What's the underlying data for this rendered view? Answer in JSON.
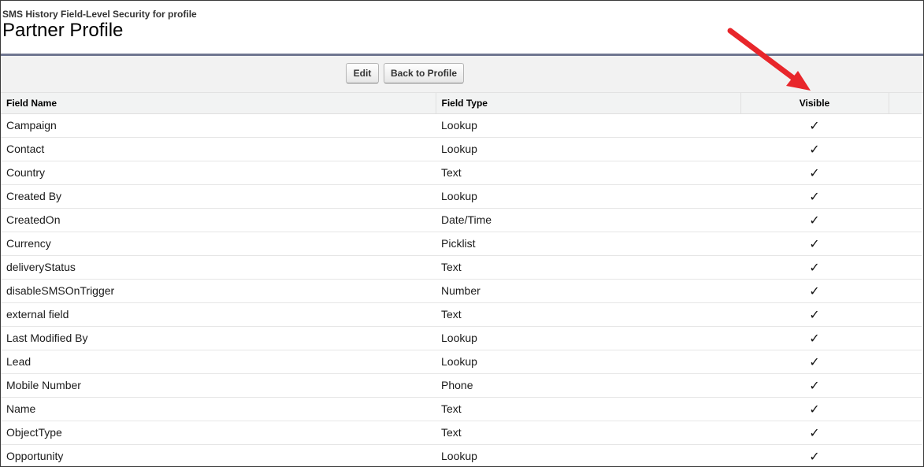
{
  "page": {
    "subtitle": "SMS History Field-Level Security for profile",
    "title": "Partner Profile"
  },
  "toolbar": {
    "edit_label": "Edit",
    "back_label": "Back to Profile"
  },
  "table": {
    "headers": [
      "Field Name",
      "Field Type",
      "Visible",
      ""
    ],
    "rows": [
      {
        "name": "Campaign",
        "type": "Lookup",
        "visible": "✓"
      },
      {
        "name": "Contact",
        "type": "Lookup",
        "visible": "✓"
      },
      {
        "name": "Country",
        "type": "Text",
        "visible": "✓"
      },
      {
        "name": "Created By",
        "type": "Lookup",
        "visible": "✓"
      },
      {
        "name": "CreatedOn",
        "type": "Date/Time",
        "visible": "✓"
      },
      {
        "name": "Currency",
        "type": "Picklist",
        "visible": "✓"
      },
      {
        "name": "deliveryStatus",
        "type": "Text",
        "visible": "✓"
      },
      {
        "name": "disableSMSOnTrigger",
        "type": "Number",
        "visible": "✓"
      },
      {
        "name": "external field",
        "type": "Text",
        "visible": "✓"
      },
      {
        "name": "Last Modified By",
        "type": "Lookup",
        "visible": "✓"
      },
      {
        "name": "Lead",
        "type": "Lookup",
        "visible": "✓"
      },
      {
        "name": "Mobile Number",
        "type": "Phone",
        "visible": "✓"
      },
      {
        "name": "Name",
        "type": "Text",
        "visible": "✓"
      },
      {
        "name": "ObjectType",
        "type": "Text",
        "visible": "✓"
      },
      {
        "name": "Opportunity",
        "type": "Lookup",
        "visible": "✓"
      }
    ]
  },
  "annotation": {
    "arrow_color": "#e8262b"
  },
  "colors": {
    "header_rule": "#6f7690",
    "toolbar_bg": "#f2f2f2",
    "table_header_bg": "#f2f3f3"
  }
}
